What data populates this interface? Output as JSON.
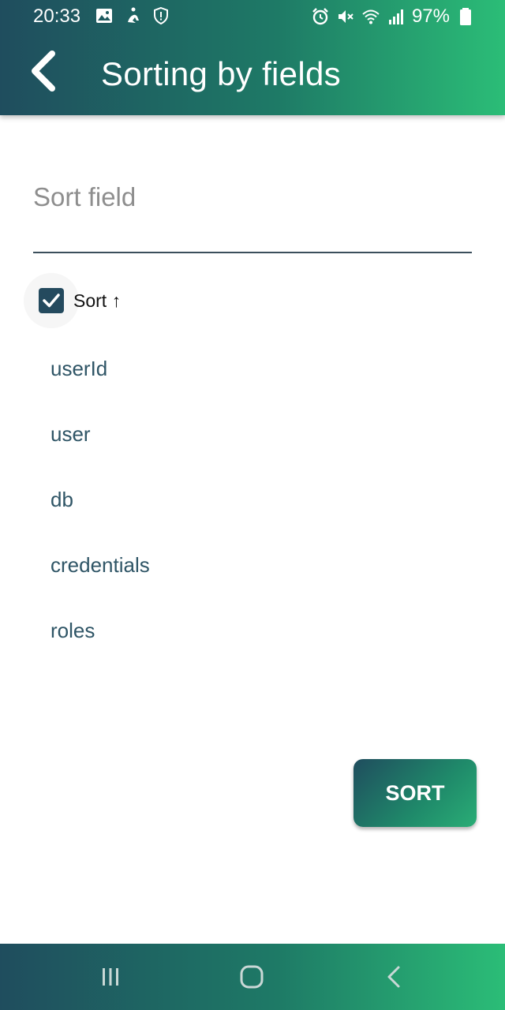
{
  "status": {
    "time": "20:33",
    "battery": "97%"
  },
  "header": {
    "title": "Sorting by fields"
  },
  "sort_field": {
    "placeholder": "Sort field",
    "value": ""
  },
  "sort_toggle": {
    "label": "Sort ↑",
    "checked": true
  },
  "fields": [
    {
      "label": "userId"
    },
    {
      "label": "user"
    },
    {
      "label": "db"
    },
    {
      "label": "credentials"
    },
    {
      "label": "roles"
    }
  ],
  "actions": {
    "sort_label": "SORT"
  },
  "colors": {
    "gradient_start": "#1f4d5e",
    "gradient_end": "#2bbd77",
    "text": "#2f5566",
    "checkbox": "#244a5e"
  },
  "icons": {
    "back": "chevron-left-icon",
    "nav_recent": "recent-apps-icon",
    "nav_home": "home-icon",
    "nav_back": "nav-back-icon"
  }
}
